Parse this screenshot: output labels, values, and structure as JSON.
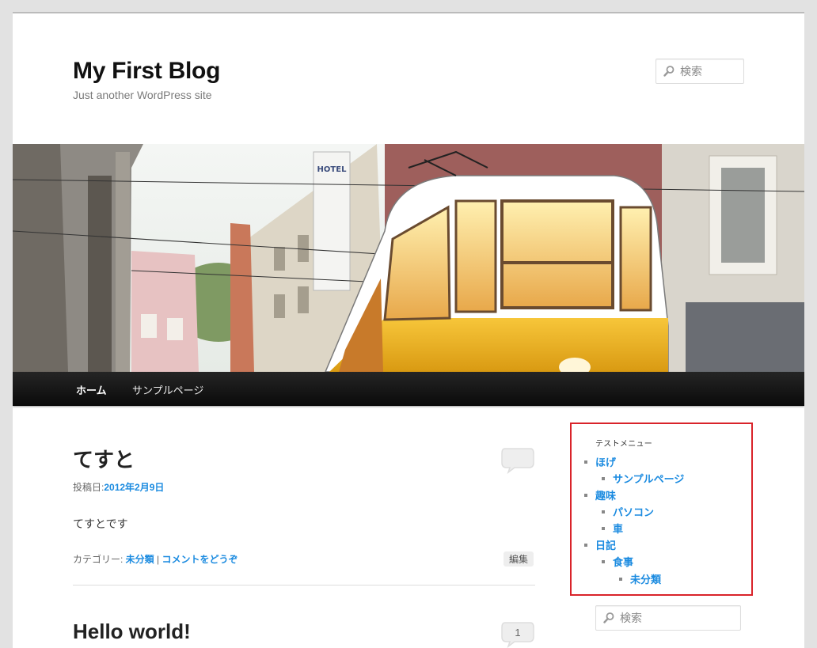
{
  "site": {
    "title": "My First Blog",
    "description": "Just another WordPress site"
  },
  "search": {
    "placeholder": "検索"
  },
  "nav": {
    "items": [
      {
        "label": "ホーム",
        "current": true
      },
      {
        "label": "サンプルページ",
        "current": false
      }
    ]
  },
  "posts": [
    {
      "title": "てすと",
      "date_prefix": "投稿日:",
      "date": "2012年2月9日",
      "content": "てすとです",
      "category_prefix": "カテゴリー: ",
      "category": "未分類",
      "separator": " | ",
      "comment_link": "コメントをどうぞ",
      "edit_label": "編集",
      "comment_count": ""
    },
    {
      "title": "Hello world!",
      "comment_count": "1"
    }
  ],
  "widget": {
    "title": "テストメニュー",
    "items": [
      {
        "label": "ほげ",
        "level": 0
      },
      {
        "label": "サンプルページ",
        "level": 1
      },
      {
        "label": "趣味",
        "level": 0
      },
      {
        "label": "パソコン",
        "level": 1
      },
      {
        "label": "車",
        "level": 1
      },
      {
        "label": "日記",
        "level": 0
      },
      {
        "label": "食事",
        "level": 1
      },
      {
        "label": "未分類",
        "level": 2
      }
    ]
  },
  "colors": {
    "link": "#1b8be0",
    "highlight_border": "#d9232a"
  }
}
